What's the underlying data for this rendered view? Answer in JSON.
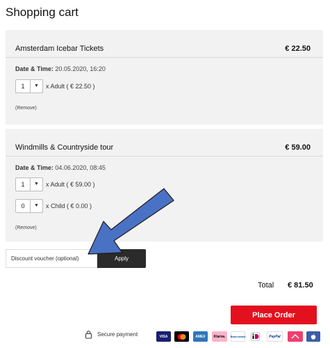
{
  "page": {
    "title": "Shopping cart"
  },
  "cart": {
    "items": [
      {
        "name": "Amsterdam Icebar Tickets",
        "price": "€ 22.50",
        "datetime_label": "Date & Time:",
        "datetime_value": "20.05.2020, 16:20",
        "tickets": [
          {
            "qty": "1",
            "label": "x Adult ( € 22.50 )"
          }
        ],
        "remove": "(Remove)"
      },
      {
        "name": "Windmills & Countryside tour",
        "price": "€ 59.00",
        "datetime_label": "Date & Time:",
        "datetime_value": "04.06.2020, 08:45",
        "tickets": [
          {
            "qty": "1",
            "label": "x Adult ( € 59.00 )"
          },
          {
            "qty": "0",
            "label": "x Child ( € 0.00 )"
          }
        ],
        "remove": "(Remove)"
      }
    ]
  },
  "voucher": {
    "placeholder": "Discount voucher (optional)",
    "apply_label": "Apply"
  },
  "summary": {
    "total_label": "Total",
    "total_value": "€ 81.50"
  },
  "actions": {
    "place_order_label": "Place Order"
  },
  "footer": {
    "secure_label": "Secure payment",
    "payment_methods": [
      {
        "name": "VISA",
        "icon": "visa-icon",
        "bg": "#1a1f71",
        "fg": "#ffffff"
      },
      {
        "name": "",
        "icon": "mastercard-icon",
        "bg": "#000000",
        "fg": "#ffffff"
      },
      {
        "name": "AMEX",
        "icon": "amex-icon",
        "bg": "#2e77bb",
        "fg": "#ffffff"
      },
      {
        "name": "Klarna.",
        "icon": "klarna-icon",
        "bg": "#ffb3c7",
        "fg": "#000000"
      },
      {
        "name": "Bancontact",
        "icon": "bancontact-icon",
        "bg": "#ffffff",
        "fg": "#005498"
      },
      {
        "name": "",
        "icon": "ideal-icon",
        "bg": "#ffffff",
        "fg": "#cc0066"
      },
      {
        "name": "PayPal",
        "icon": "paypal-icon",
        "bg": "#ffffff",
        "fg": "#003087"
      },
      {
        "name": "",
        "icon": "sofort-icon",
        "bg": "#ee3f6f",
        "fg": "#ffffff"
      },
      {
        "name": "",
        "icon": "applepay-icon",
        "bg": "#3b5da8",
        "fg": "#ffffff"
      }
    ]
  },
  "colors": {
    "accent": "#e3101e",
    "panel": "#f2f2f2",
    "apply_bg": "#2b2b2b",
    "annotation_arrow": "#4a72c4"
  }
}
